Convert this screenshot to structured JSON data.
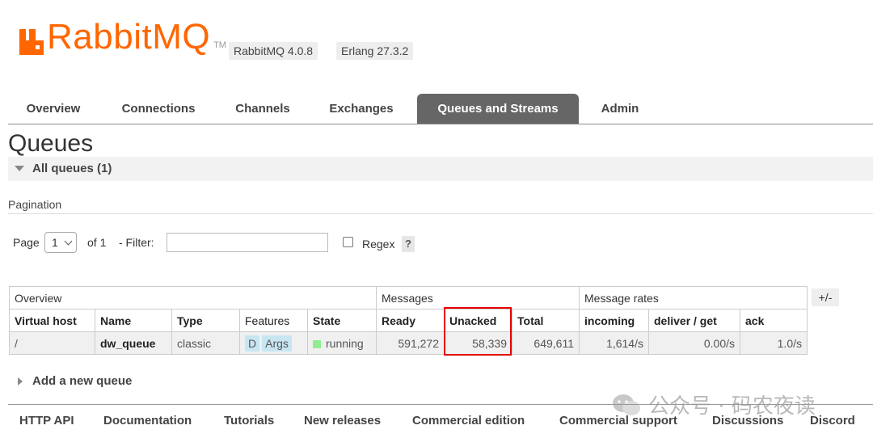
{
  "header": {
    "logo_text": "RabbitMQ",
    "logo_tm": "TM",
    "version_badge": "RabbitMQ 4.0.8",
    "erlang_badge": "Erlang 27.3.2",
    "brand_color": "#ff6600"
  },
  "tabs": [
    {
      "label": "Overview",
      "active": false
    },
    {
      "label": "Connections",
      "active": false
    },
    {
      "label": "Channels",
      "active": false
    },
    {
      "label": "Exchanges",
      "active": false
    },
    {
      "label": "Queues and Streams",
      "active": true
    },
    {
      "label": "Admin",
      "active": false
    }
  ],
  "page": {
    "title": "Queues",
    "section_label": "All queues (1)",
    "pagination_label": "Pagination"
  },
  "pagination": {
    "page_label": "Page",
    "page_value": "1",
    "of_label": "of 1",
    "filter_label": "- Filter:",
    "filter_value": "",
    "regex_label": "Regex",
    "help_label": "?"
  },
  "table": {
    "groups": [
      "Overview",
      "Messages",
      "Message rates"
    ],
    "plus_minus": "+/-",
    "columns": [
      "Virtual host",
      "Name",
      "Type",
      "Features",
      "State",
      "Ready",
      "Unacked",
      "Total",
      "incoming",
      "deliver / get",
      "ack"
    ],
    "rows": [
      {
        "vhost": "/",
        "name": "dw_queue",
        "type": "classic",
        "feature_d": "D",
        "feature_args": "Args",
        "state": "running",
        "ready": "591,272",
        "unacked": "58,339",
        "total": "649,611",
        "incoming": "1,614/s",
        "deliver_get": "0.00/s",
        "ack": "1.0/s"
      }
    ]
  },
  "add_queue_label": "Add a new queue",
  "footer": [
    "HTTP API",
    "Documentation",
    "Tutorials",
    "New releases",
    "Commercial edition",
    "Commercial support",
    "Discussions",
    "Discord"
  ],
  "watermark": "公众号 · 码农夜读"
}
